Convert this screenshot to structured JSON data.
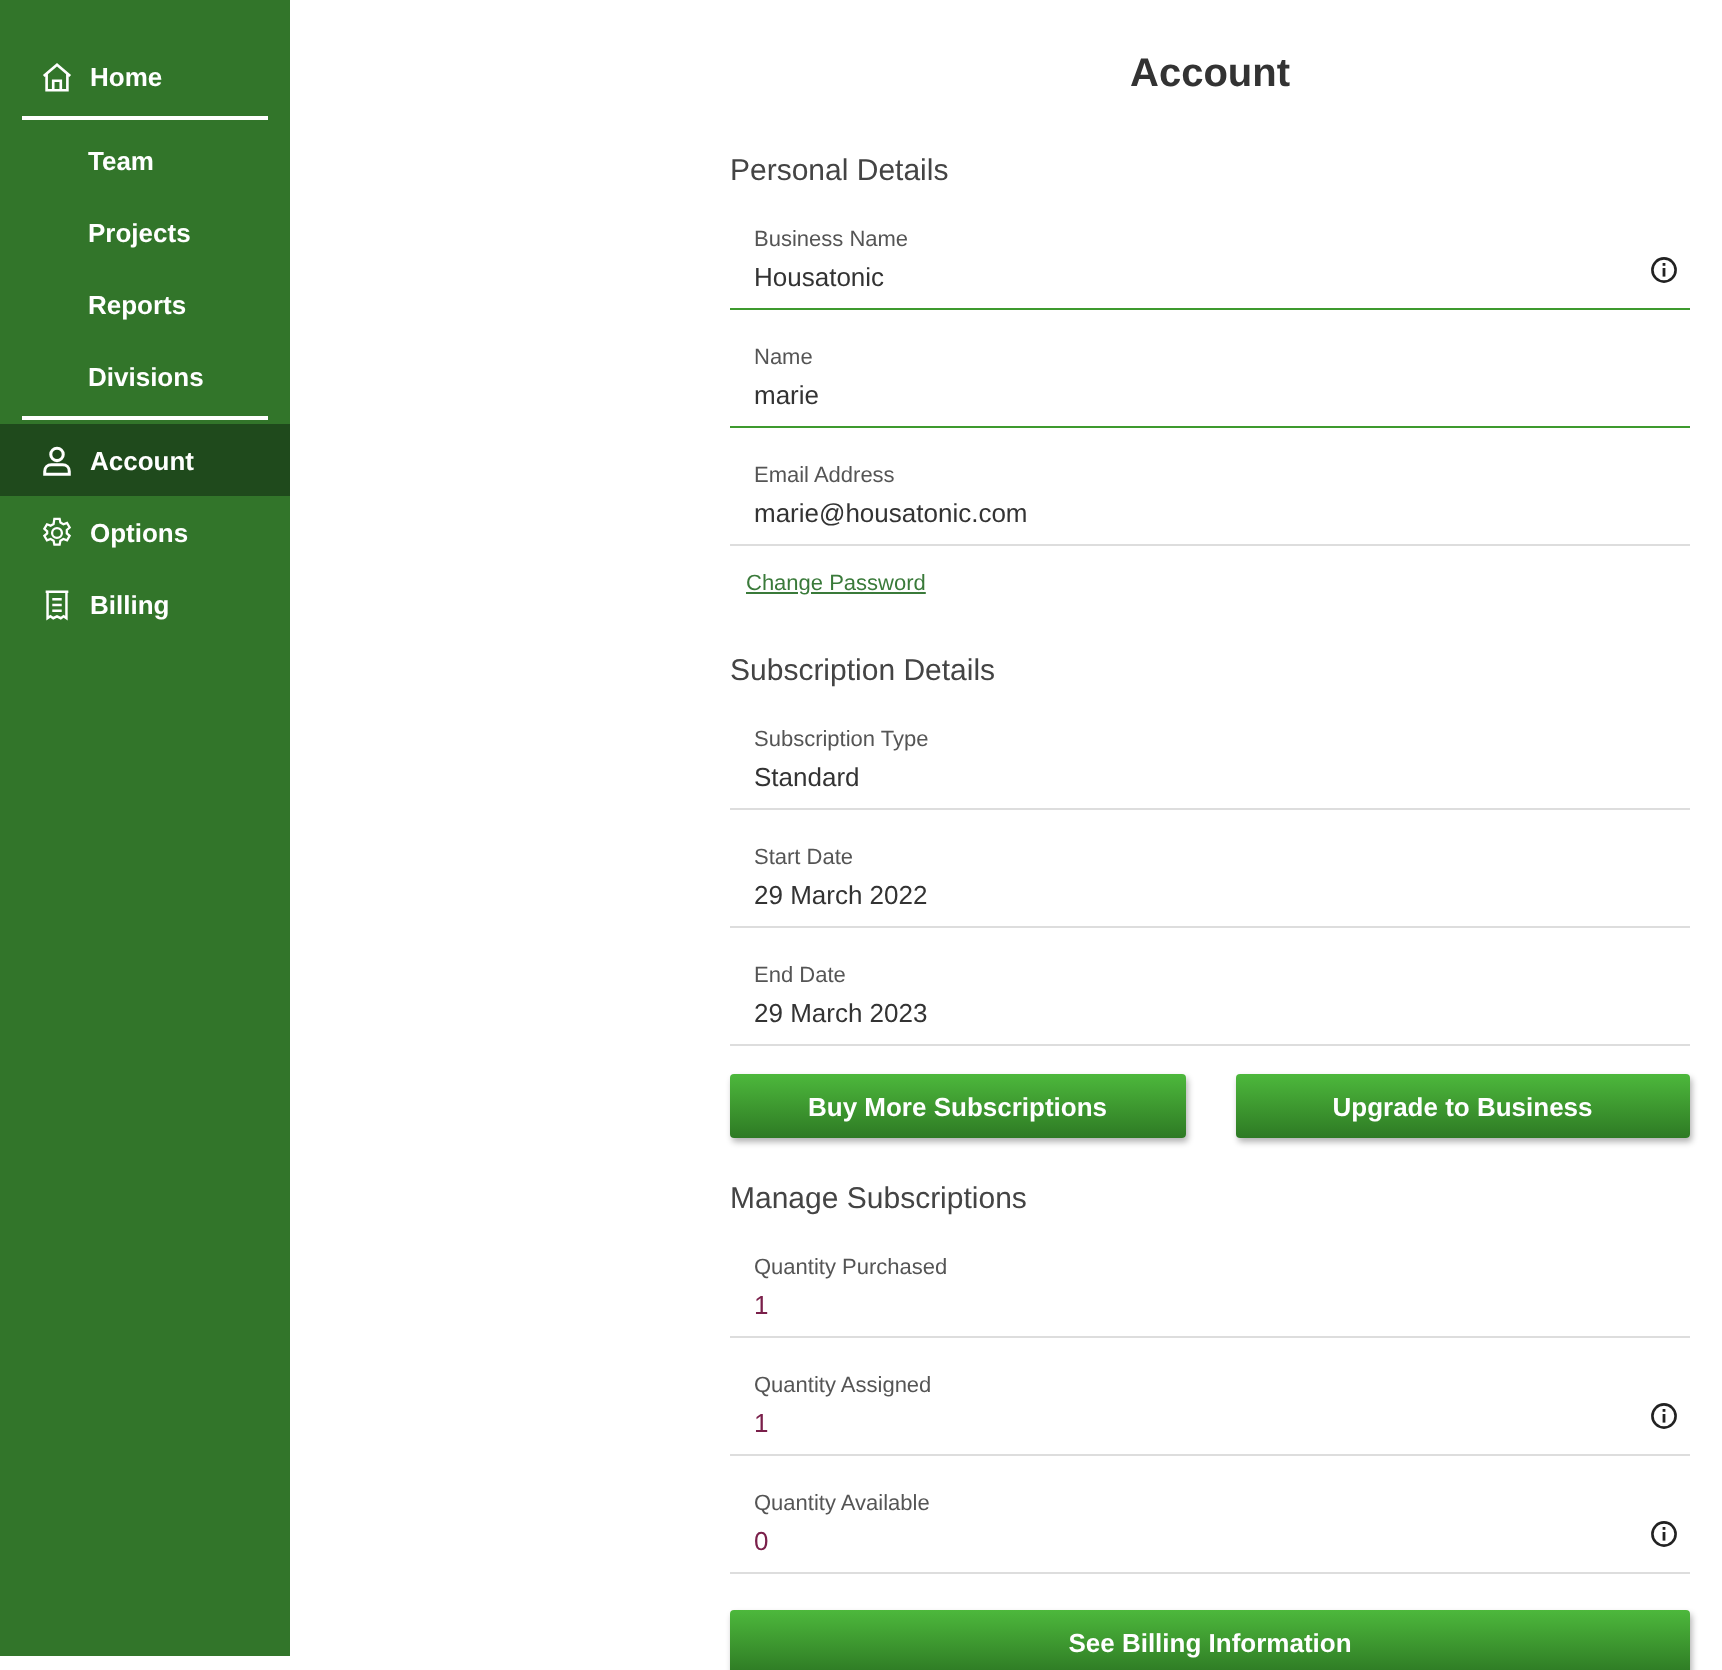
{
  "sidebar": {
    "items": [
      {
        "label": "Home",
        "kind": "main",
        "selected": false
      },
      {
        "label": "Team",
        "kind": "sub",
        "selected": false
      },
      {
        "label": "Projects",
        "kind": "sub",
        "selected": false
      },
      {
        "label": "Reports",
        "kind": "sub",
        "selected": false
      },
      {
        "label": "Divisions",
        "kind": "sub",
        "selected": false
      },
      {
        "label": "Account",
        "kind": "main",
        "selected": true
      },
      {
        "label": "Options",
        "kind": "main",
        "selected": false
      },
      {
        "label": "Billing",
        "kind": "main",
        "selected": false
      }
    ]
  },
  "title": "Account",
  "sections": [
    {
      "heading": "Personal Details",
      "fields": [
        {
          "label": "Business Name",
          "value": "Housatonic",
          "kind": "editable",
          "info": true
        },
        {
          "label": "Name",
          "value": "marie",
          "kind": "editable",
          "info": false
        },
        {
          "label": "Email Address",
          "value": "marie@housatonic.com",
          "kind": "readonly",
          "info": false
        }
      ],
      "link": "Change Password"
    },
    {
      "heading": "Subscription Details",
      "fields": [
        {
          "label": "Subscription Type",
          "value": "Standard",
          "kind": "readonly",
          "info": false
        },
        {
          "label": "Start Date",
          "value": "29 March 2022",
          "kind": "readonly",
          "info": false
        },
        {
          "label": "End Date",
          "value": "29 March 2023",
          "kind": "readonly",
          "info": false
        }
      ],
      "buttons": [
        "Buy More Subscriptions",
        "Upgrade to Business"
      ]
    },
    {
      "heading": "Manage Subscriptions",
      "fields": [
        {
          "label": "Quantity Purchased",
          "value": "1",
          "kind": "count",
          "info": false
        },
        {
          "label": "Quantity Assigned",
          "value": "1",
          "kind": "count",
          "info": true
        },
        {
          "label": "Quantity Available",
          "value": "0",
          "kind": "count",
          "info": true
        }
      ],
      "buttons": [
        "See Billing Information"
      ]
    }
  ]
}
